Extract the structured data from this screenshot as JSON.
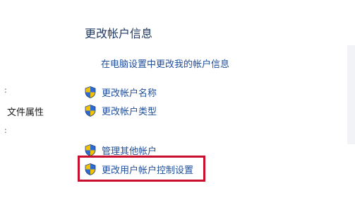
{
  "left_pane": {
    "items": [
      {
        "label": "文件属性"
      }
    ]
  },
  "main": {
    "title": "更改帐户信息",
    "pc_settings_link": "在电脑设置中更改我的帐户信息",
    "tasks": [
      {
        "label": "更改帐户名称",
        "icon": "uac-shield-icon"
      },
      {
        "label": "更改帐户类型",
        "icon": "uac-shield-icon"
      },
      {
        "label": "管理其他帐户",
        "icon": "uac-shield-icon"
      },
      {
        "label": "更改用户帐户控制设置",
        "icon": "uac-shield-icon",
        "highlighted": true
      }
    ]
  },
  "colors": {
    "title": "#1f3a66",
    "link": "#1f4e9c",
    "highlight_border": "#c8102e",
    "shield_blue": "#2e6ad1",
    "shield_yellow": "#f2c200"
  }
}
